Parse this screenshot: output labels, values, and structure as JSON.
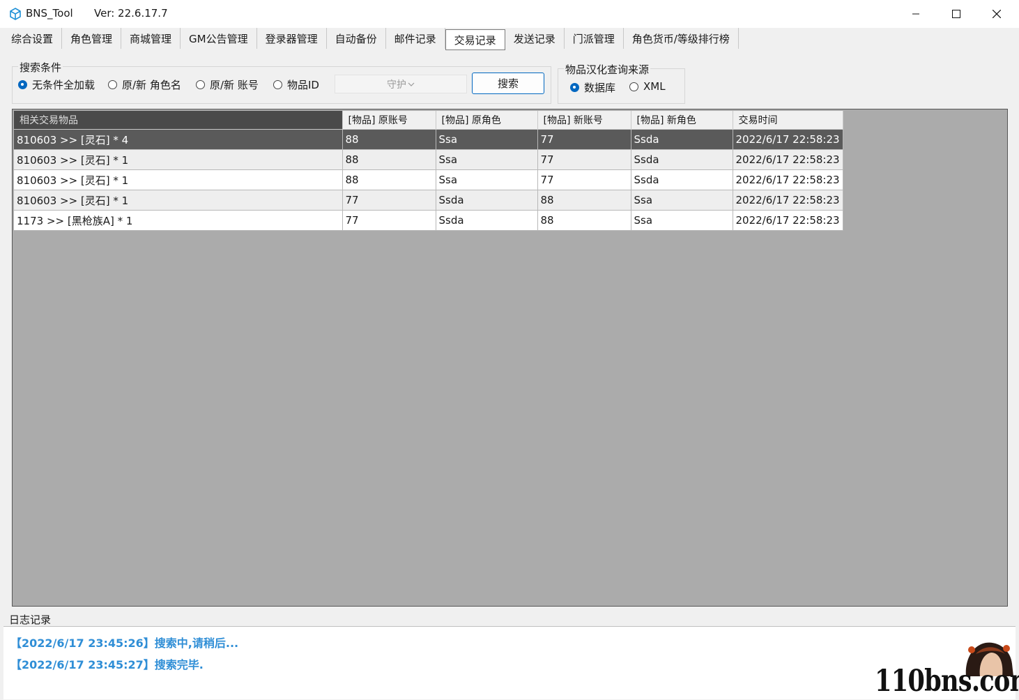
{
  "window": {
    "title": "BNS_Tool",
    "version": "Ver:  22.6.17.7"
  },
  "tabs": [
    {
      "label": "综合设置",
      "active": false
    },
    {
      "label": "角色管理",
      "active": false
    },
    {
      "label": "商城管理",
      "active": false
    },
    {
      "label": "GM公告管理",
      "active": false
    },
    {
      "label": "登录器管理",
      "active": false
    },
    {
      "label": "自动备份",
      "active": false
    },
    {
      "label": "邮件记录",
      "active": false
    },
    {
      "label": "交易记录",
      "active": true
    },
    {
      "label": "发送记录",
      "active": false
    },
    {
      "label": "门派管理",
      "active": false
    },
    {
      "label": "角色货币/等级排行榜",
      "active": false
    }
  ],
  "search": {
    "group_title": "搜索条件",
    "options": [
      {
        "label": "无条件全加载",
        "checked": true
      },
      {
        "label": "原/新 角色名",
        "checked": false
      },
      {
        "label": "原/新 账号",
        "checked": false
      },
      {
        "label": "物品ID",
        "checked": false
      }
    ],
    "combo_value": "守护",
    "button_label": "搜索"
  },
  "source": {
    "group_title": "物品汉化查询来源",
    "options": [
      {
        "label": "数据库",
        "checked": true
      },
      {
        "label": "XML",
        "checked": false
      }
    ]
  },
  "grid": {
    "columns": [
      "相关交易物品",
      "[物品] 原账号",
      "[物品] 原角色",
      "[物品] 新账号",
      "[物品] 新角色",
      "交易时间"
    ],
    "rows": [
      [
        "810603 >> [灵石] * 4",
        "88",
        "Ssa",
        "77",
        "Ssda",
        "2022/6/17 22:58:23"
      ],
      [
        "810603 >> [灵石] * 1",
        "88",
        "Ssa",
        "77",
        "Ssda",
        "2022/6/17 22:58:23"
      ],
      [
        "810603 >> [灵石] * 1",
        "88",
        "Ssa",
        "77",
        "Ssda",
        "2022/6/17 22:58:23"
      ],
      [
        "810603 >> [灵石] * 1",
        "77",
        "Ssda",
        "88",
        "Ssa",
        "2022/6/17 22:58:23"
      ],
      [
        "1173 >> [黑枪族A] * 1",
        "77",
        "Ssda",
        "88",
        "Ssa",
        "2022/6/17 22:58:23"
      ]
    ],
    "selected_row": 0
  },
  "log": {
    "label": "日志记录",
    "lines": [
      "【2022/6/17 23:45:26】搜索中,请稍后...",
      "【2022/6/17 23:45:27】搜索完毕."
    ],
    "color": "#2f8ed6"
  },
  "watermark": "110bns.com",
  "colors": {
    "accent": "#0067c0",
    "grid_bg": "#ababab",
    "selected_row": "#5a5a5a"
  }
}
